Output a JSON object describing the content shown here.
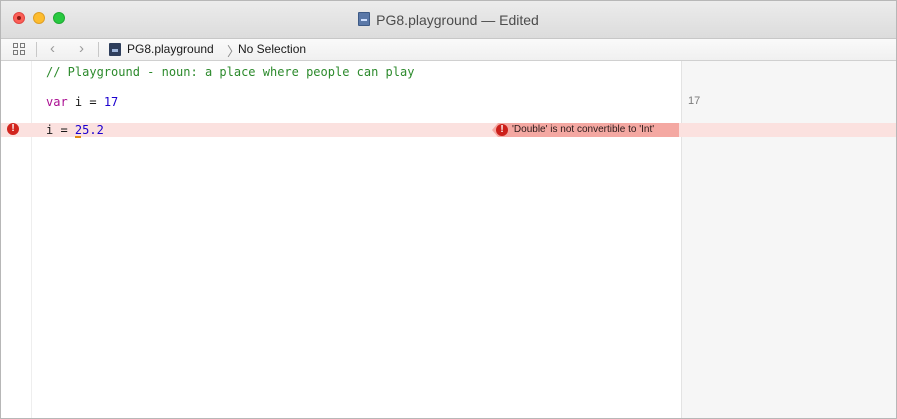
{
  "window": {
    "title": "PG8.playground — Edited"
  },
  "jumpbar": {
    "file": "PG8.playground",
    "separator": "〉",
    "selection": "No Selection"
  },
  "code": {
    "line1": "// Playground - noun: a place where people can play",
    "line2_kw": "var",
    "line2_rest": " i = ",
    "line2_num": "17",
    "line3_plain": "i = ",
    "line3_num": "25.2"
  },
  "results": {
    "line2_value": "17"
  },
  "error": {
    "message": "'Double' is not convertible to 'Int'",
    "marker_glyph": "!"
  },
  "icons": [
    "close-icon",
    "minimize-icon",
    "zoom-icon",
    "related-items-icon",
    "back-arrow-icon",
    "forward-arrow-icon",
    "playground-file-icon",
    "error-icon"
  ],
  "colors": {
    "error_background": "#fbe1df",
    "error_bubble": "#f4a8a2",
    "keyword": "#aa0d91",
    "number": "#1c00cf",
    "comment": "#2c8a2c"
  }
}
